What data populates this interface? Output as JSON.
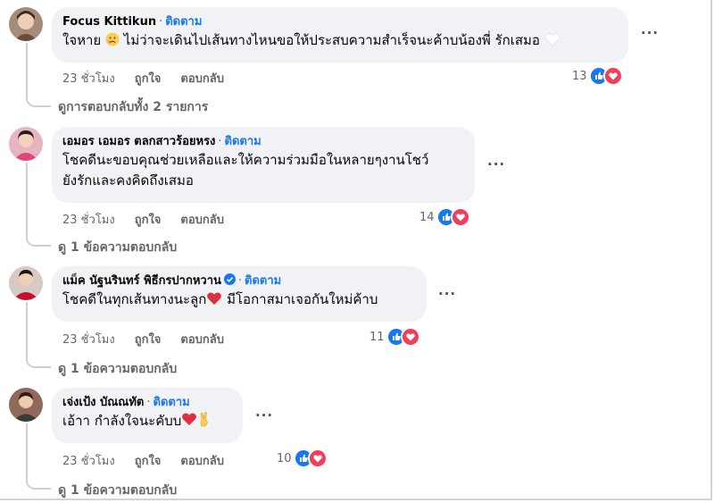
{
  "comments": [
    {
      "name": "Focus Kittikun",
      "follow": "ติดตาม",
      "verified": false,
      "line1": "ใจหาย",
      "line1_emoji": "sad-face-emoji",
      "line1b": "ไม่ว่าจะเดินไปเส้นทางไหนขอให้ประสบความสำเร็จนะค้าบน้องพี่ รักเสมอ",
      "line1_end_emoji": "white-heart-emoji",
      "time": "23 ชั่วโมง",
      "like": "ถูกใจ",
      "reply": "ตอบกลับ",
      "reactions": "13",
      "view_replies": "ดูการตอบกลับทั้ง 2 รายการ"
    },
    {
      "name": "เอมอร เอมอร ตลกสาวร้อยหรง",
      "follow": "ติดตาม",
      "verified": false,
      "line1": "โชคดีนะขอบคุณช่วยเหลือและให้ความร่วมมือในหลายๆงานโชว์",
      "line2": "ยังรักและคงคิดถึงเสมอ",
      "time": "23 ชั่วโมง",
      "like": "ถูกใจ",
      "reply": "ตอบกลับ",
      "reactions": "14",
      "view_replies": "ดู 1 ข้อความตอบกลับ"
    },
    {
      "name": "แม็ค นัฐนรินทร์ พิธีกรปากหวาน",
      "follow": "ติดตาม",
      "verified": true,
      "line1": "โชคดีในทุกเส้นทางนะลูก",
      "line1_emoji": "red-heart-emoji",
      "line1b": "มีโอกาสมาเจอกันใหม่ค้าบ",
      "time": "23 ชั่วโมง",
      "like": "ถูกใจ",
      "reply": "ตอบกลับ",
      "reactions": "11",
      "view_replies": "ดู 1 ข้อความตอบกลับ"
    },
    {
      "name": "เจ่งเป้ง บัณณทัต",
      "follow": "ติดตาม",
      "verified": false,
      "line1": "เอ้าา กำลังใจนะคับบ",
      "line1_end_emoji": "heart-and-victory-emoji",
      "time": "23 ชั่วโมง",
      "like": "ถูกใจ",
      "reply": "ตอบกลับ",
      "reactions": "10",
      "view_replies": "ดู 1 ข้อความตอบกลับ"
    }
  ],
  "more_label": "···",
  "colors": {
    "link": "#1877f2",
    "bubble": "#f0f2f5",
    "meta": "#65676b",
    "like": "#1877f2",
    "love": "#f33e58"
  }
}
